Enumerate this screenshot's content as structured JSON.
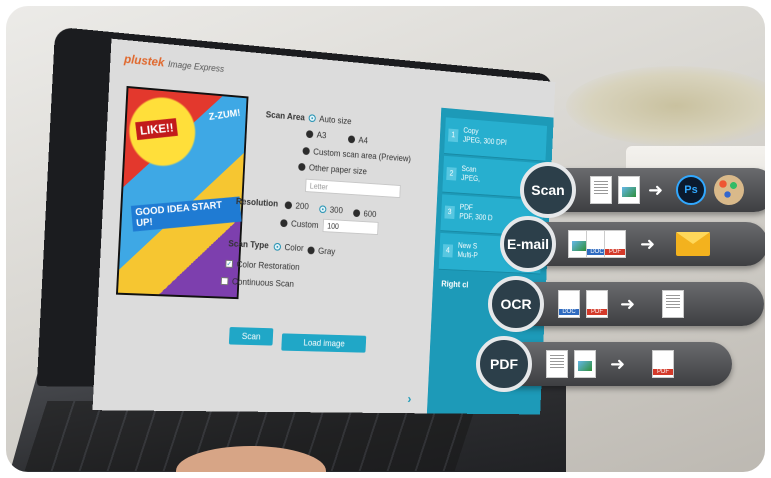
{
  "app": {
    "brand": "plustek",
    "product": "Image Express",
    "window_controls": "? – ☐ ✕"
  },
  "scan_area": {
    "label": "Scan Area",
    "options": [
      "Auto size",
      "A3",
      "A4",
      "Custom scan area (Preview)",
      "Other paper size"
    ],
    "selected": "Auto size",
    "paper_size_placeholder": "Letter"
  },
  "resolution": {
    "label": "Resolution",
    "options": [
      "200",
      "300",
      "600",
      "Custom"
    ],
    "selected": "300",
    "custom_value": "100"
  },
  "scan_type": {
    "label": "Scan Type",
    "options": [
      "Color",
      "Gray"
    ],
    "selected": "Color"
  },
  "checkboxes": {
    "color_restoration": "Color Restoration",
    "continuous_scan": "Continuous Scan"
  },
  "buttons": {
    "scan": "Scan",
    "load_image": "Load image",
    "next_arrow": "›"
  },
  "artwork_text": {
    "like": "LIKE!!",
    "zoom": "Z-ZUM!",
    "good_idea": "GOOD IDEA START UP!"
  },
  "side_panel": {
    "items": [
      {
        "num": "1",
        "title": "Copy",
        "sub": "JPEG, 300 DPI"
      },
      {
        "num": "2",
        "title": "Scan",
        "sub": "JPEG,"
      },
      {
        "num": "3",
        "title": "PDF",
        "sub": "PDF, 300 D"
      },
      {
        "num": "4",
        "title": "New S",
        "sub": "Multi-P"
      }
    ],
    "footer": "Right cl"
  },
  "features": [
    {
      "badge": "Scan"
    },
    {
      "badge": "E-mail"
    },
    {
      "badge": "OCR"
    },
    {
      "badge": "PDF"
    }
  ],
  "icons": {
    "ps_label": "Ps",
    "pdf_tag": "PDF",
    "doc_tag": "DOC",
    "arrow": "➜"
  }
}
